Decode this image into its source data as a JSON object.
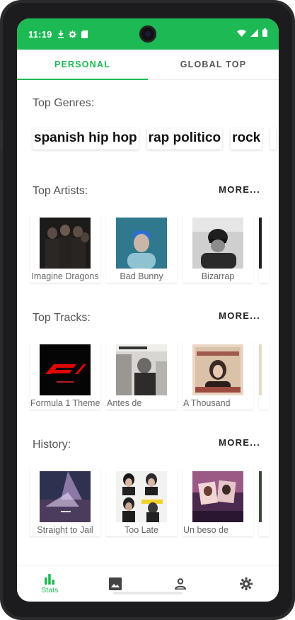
{
  "status_bar": {
    "time": "11:19",
    "bg_color": "#1db954",
    "left_icons": [
      "download-icon",
      "gear-icon",
      "sd-card-icon"
    ],
    "right_icons": [
      "wifi-icon",
      "signal-icon",
      "battery-icon"
    ]
  },
  "tabs": [
    {
      "label": "PERSONAL",
      "active": true
    },
    {
      "label": "GLOBAL TOP",
      "active": false
    }
  ],
  "sections": {
    "genres": {
      "title": "Top Genres:",
      "chips": [
        "spanish hip hop",
        "rap politico",
        "rock"
      ]
    },
    "artists": {
      "title": "Top Artists:",
      "more": "MORE...",
      "items": [
        {
          "label": "Imagine Dragons"
        },
        {
          "label": "Bad Bunny"
        },
        {
          "label": "Bizarrap"
        }
      ]
    },
    "tracks": {
      "title": "Top Tracks:",
      "more": "MORE...",
      "items": [
        {
          "label": "Formula 1 Theme"
        },
        {
          "label": "Antes de"
        },
        {
          "label": "A Thousand"
        }
      ]
    },
    "history": {
      "title": "History:",
      "more": "MORE...",
      "items": [
        {
          "label": "Straight to Jail"
        },
        {
          "label": "Too Late"
        },
        {
          "label": "Un beso de"
        }
      ]
    }
  },
  "bottom_nav": [
    {
      "icon": "bar-chart-icon",
      "label": "Stats",
      "active": true
    },
    {
      "icon": "image-icon",
      "label": "",
      "active": false
    },
    {
      "icon": "person-icon",
      "label": "",
      "active": false
    },
    {
      "icon": "settings-icon",
      "label": "",
      "active": false
    }
  ],
  "colors": {
    "accent": "#1db954",
    "text": "#555555"
  }
}
